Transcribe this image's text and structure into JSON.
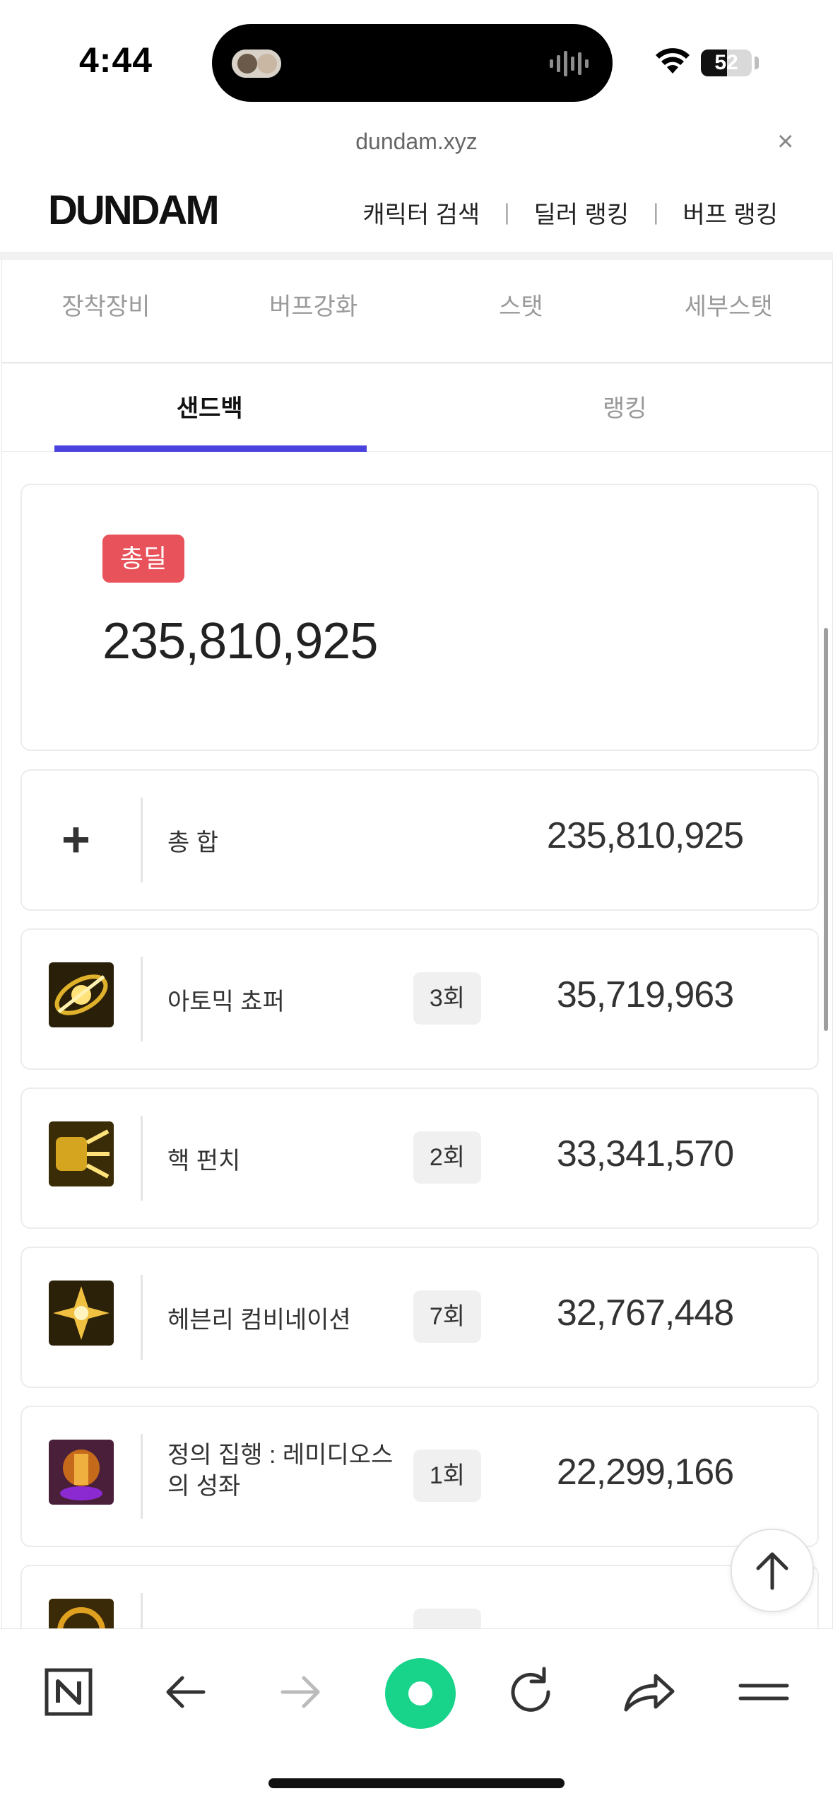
{
  "status_bar": {
    "time": "4:44",
    "battery_level": "52",
    "battery_fraction": 0.52
  },
  "url_bar": {
    "url": "dundam.xyz",
    "close_label": "×"
  },
  "header": {
    "logo": "DUNDAM",
    "nav": [
      {
        "label": "캐릭터 검색"
      },
      {
        "label": "딜러 랭킹"
      },
      {
        "label": "버프 랭킹"
      }
    ],
    "nav_separator": "|"
  },
  "top_tabs": [
    {
      "label": "장착장비"
    },
    {
      "label": "버프강화"
    },
    {
      "label": "스탯"
    },
    {
      "label": "세부스탯"
    }
  ],
  "sub_tabs": [
    {
      "label": "샌드백",
      "active": true
    },
    {
      "label": "랭킹",
      "active": false
    }
  ],
  "total": {
    "badge": "총딜",
    "value": "235,810,925",
    "badge_color": "#e8525a"
  },
  "summary_row": {
    "icon": "plus-icon",
    "plus": "+",
    "name": "총 합",
    "value": "235,810,925"
  },
  "skills": [
    {
      "name": "아토믹 쵸퍼",
      "count": "3회",
      "value": "35,719,963",
      "icon": "atomic-chopper-icon"
    },
    {
      "name": "핵 펀치",
      "count": "2회",
      "value": "33,341,570",
      "icon": "nuclear-punch-icon"
    },
    {
      "name": "헤븐리 컴비네이션",
      "count": "7회",
      "value": "32,767,448",
      "icon": "heavenly-combination-icon"
    },
    {
      "name": "정의 집행 : 레미디오스의 성좌",
      "name_line1": "정의 집행 : 레미디오스",
      "name_line2": "의 성좌",
      "count": "1회",
      "value": "22,299,166",
      "icon": "remedios-constellation-icon"
    },
    {
      "name": "",
      "count": "",
      "value": "",
      "icon": "partial-skill-icon"
    }
  ],
  "colors": {
    "accent": "#4b43de",
    "badge": "#e8525a",
    "fab_accent": "#18d38a"
  }
}
